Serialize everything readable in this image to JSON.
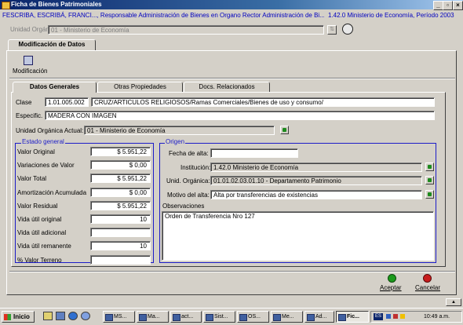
{
  "window": {
    "title": "Ficha de Bienes Patrimoniales",
    "min": "_",
    "max": "▫",
    "close": "×"
  },
  "infobar": {
    "user": "FESCRIBA, ESCRIBÁ, FRANCI..., Responsable Administración de Bienes en Organo Rector Administración de Bi...",
    "context": "1.42.0 Ministerio de Economía, Período 2003"
  },
  "unidad": {
    "label": "Unidad Orgánica:",
    "value": "01 - Ministerio de Economía"
  },
  "main_tab": "Modificación de Datos",
  "toolbar": {
    "modificacion_label": "Modificación"
  },
  "tabs": [
    "Datos Generales",
    "Otras Propiedades",
    "Docs. Relacionados"
  ],
  "clase": {
    "label": "Clase",
    "code": "1.01.005.002",
    "desc": "CRUZ/ARTICULOS RELIGIOSOS/Ramas Comerciales/Bienes de uso y consumo/"
  },
  "especific": {
    "label": "Especific.",
    "value": "MADERA CON IMAGEN"
  },
  "unidad_actual": {
    "label": "Unidad Orgánica Actual:",
    "value": "01 - Ministerio de Economía"
  },
  "estado": {
    "title": "Estado general",
    "rows": [
      {
        "label": "Valor Original",
        "value": "$ 5.951,22"
      },
      {
        "label": "Variaciones de Valor",
        "value": "$ 0,00"
      },
      {
        "label": "Valor Total",
        "value": "$ 5.951,22"
      },
      {
        "label": "Amortización Acumulada",
        "value": "$ 0,00"
      },
      {
        "label": "Valor Residual",
        "value": "$ 5.951,22"
      },
      {
        "label": "Vida útil original",
        "value": "10"
      },
      {
        "label": "Vida útil adicional",
        "value": ""
      },
      {
        "label": "Vida útil remanente",
        "value": "10"
      },
      {
        "label": "% Valor Terreno",
        "value": ""
      }
    ]
  },
  "origen": {
    "title": "Origen",
    "fecha_label": "Fecha de alta:",
    "fecha_value": "",
    "institucion_label": "Institución:",
    "institucion_value": "1.42.0 Ministerio de Economía",
    "unid_label": "Unid. Orgánica:",
    "unid_value": "01.01.02.03.01.10 - Departamento Patrimonio",
    "motivo_label": "Motivo del alta:",
    "motivo_value": "Alta por transferencias de existencias",
    "obs_label": "Observaciones",
    "obs_value": "Orden de Transferencia Nro 127"
  },
  "actions": {
    "aceptar": "Aceptar",
    "cancelar": "Cancelar"
  },
  "taskbar": {
    "start": "Inicio",
    "items": [
      "MS...",
      "Ma...",
      "act...",
      "Sist...",
      "OS...",
      "Me...",
      "Ad...",
      "Fic..."
    ],
    "lang": "ES",
    "clock": "10:49 a.m."
  }
}
